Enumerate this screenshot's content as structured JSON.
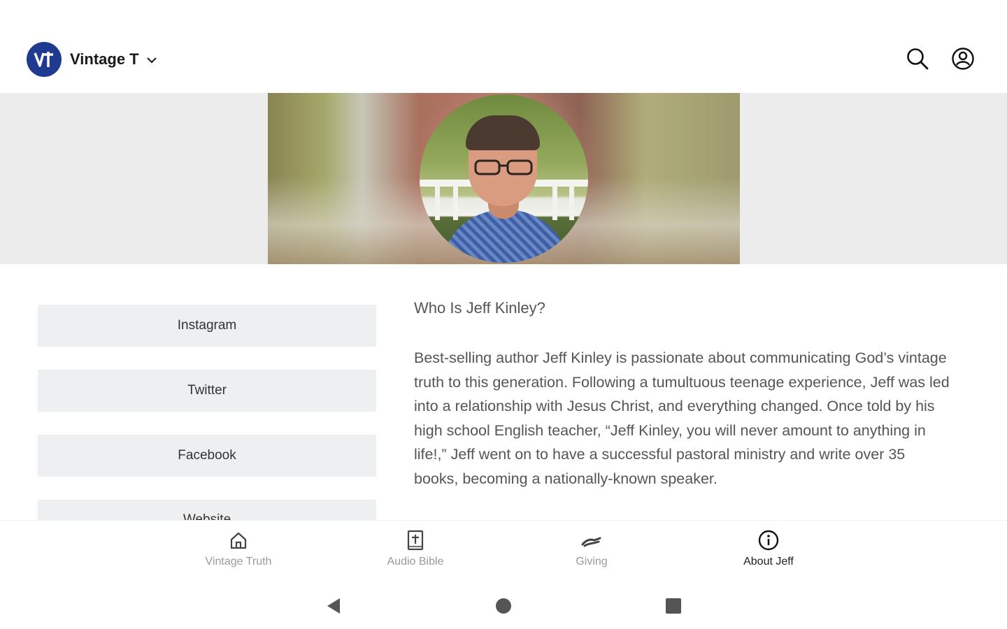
{
  "header": {
    "app_name": "Vintage T",
    "logo_text": "VT",
    "icons": {
      "logo": "vt-logo-icon",
      "dropdown": "chevron-down-icon",
      "search": "search-icon",
      "profile": "profile-icon"
    }
  },
  "sidebar": {
    "links": [
      {
        "label": "Instagram"
      },
      {
        "label": "Twitter"
      },
      {
        "label": "Facebook"
      },
      {
        "label": "Website"
      }
    ]
  },
  "about": {
    "title": "Who Is Jeff Kinley?",
    "body": "Best-selling author Jeff Kinley is passionate about communicating God’s vintage truth to this generation. Following a tumultuous teenage experience, Jeff was led into a relationship with Jesus Christ, and everything changed. Once told by his high school English teacher, “Jeff Kinley, you will never amount to anything in life!,” Jeff went on to have a successful pastoral ministry and write over 35 books, becoming a nationally-known speaker."
  },
  "tabs": [
    {
      "label": "Vintage Truth",
      "icon": "home-icon",
      "active": false
    },
    {
      "label": "Audio Bible",
      "icon": "bible-icon",
      "active": false
    },
    {
      "label": "Giving",
      "icon": "giving-hand-icon",
      "active": false
    },
    {
      "label": "About Jeff",
      "icon": "info-icon",
      "active": true
    }
  ],
  "system_nav": {
    "back": "back-icon",
    "home": "home-circle-icon",
    "recents": "recents-icon"
  },
  "colors": {
    "brand": "#1f3b8f",
    "banner_bg": "#ececed",
    "link_bg": "#eeeff0",
    "text_muted": "#555555"
  }
}
